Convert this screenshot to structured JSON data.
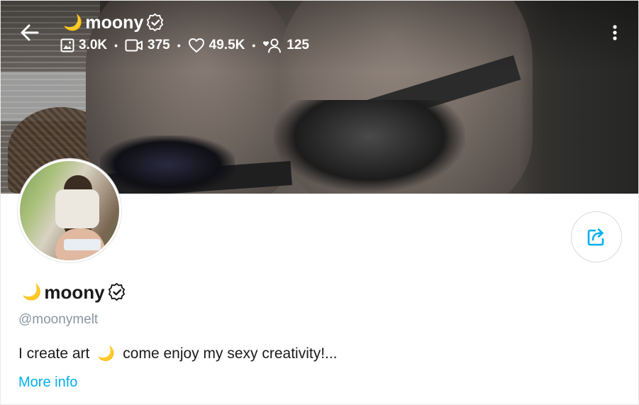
{
  "header": {
    "title_emoji": "🌙",
    "title": "moony",
    "verified_icon": "verified-badge-icon"
  },
  "stats": {
    "photos": "3.0K",
    "videos": "375",
    "likes": "49.5K",
    "fans": "125"
  },
  "icons": {
    "back": "arrow-left-icon",
    "photos": "image-icon",
    "videos": "video-camera-icon",
    "likes": "heart-icon",
    "fans": "user-heart-icon",
    "more": "vertical-dots-icon",
    "share": "share-icon"
  },
  "profile": {
    "name_emoji": "🌙",
    "display_name": "moony",
    "handle": "@moonymelt",
    "bio_start": "I create art",
    "bio_emoji": "🌙",
    "bio_end": "come enjoy my sexy creativity!...",
    "more_info_label": "More info"
  },
  "colors": {
    "accent": "#00aff0",
    "handle_gray": "#8a96a3",
    "moon": "#f6c12e"
  }
}
